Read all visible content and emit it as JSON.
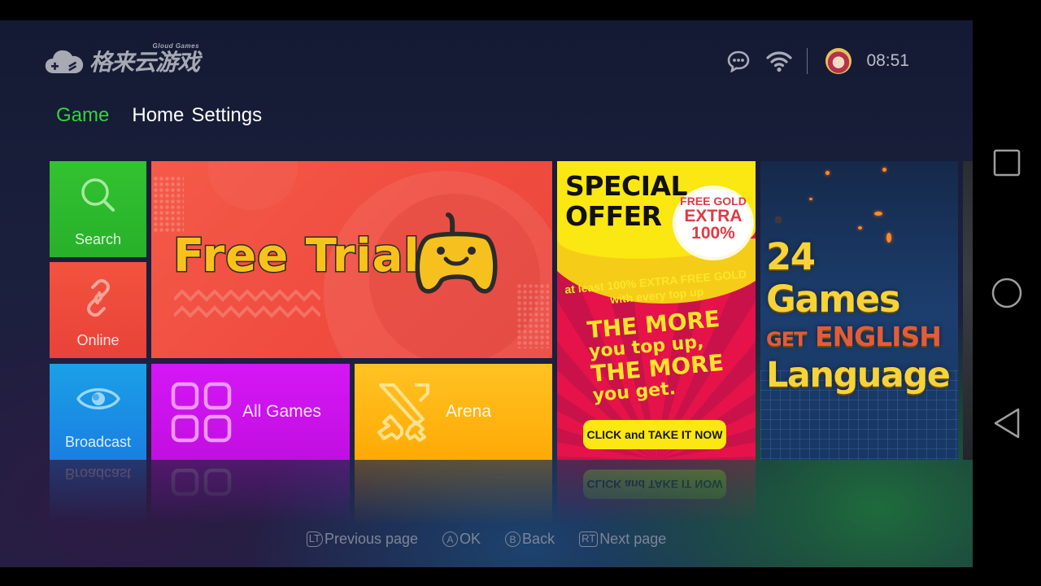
{
  "app": {
    "logo_text": "格来云游戏",
    "logo_subtitle": "Gloud Games"
  },
  "status": {
    "icons": [
      "message-icon",
      "wifi-icon"
    ],
    "time": "08:51"
  },
  "nav": {
    "tabs": [
      {
        "label": "Game",
        "active": true
      },
      {
        "label": "Home",
        "active": false
      },
      {
        "label": "Settings",
        "active": false
      }
    ]
  },
  "tiles": {
    "search": {
      "label": "Search",
      "icon": "search-icon",
      "color": "#2fbd2e"
    },
    "online": {
      "label": "Online",
      "icon": "link-icon",
      "color": "#ef4b3c"
    },
    "broadcast": {
      "label": "Broadcast",
      "icon": "eye-icon",
      "color": "#1a90e4"
    },
    "free_trial": {
      "title": "Free Trial",
      "icon": "gamepad-icon",
      "color": "#f05040"
    },
    "all_games": {
      "label": "All Games",
      "icon": "grid-icon",
      "color": "#cc13ec"
    },
    "arena": {
      "label": "Arena",
      "icon": "crossed-swords-icon",
      "color": "#ffb612"
    },
    "special_offer": {
      "heading_line1": "SPECIAL",
      "heading_line2": "OFFER",
      "badge_line1": "FREE GOLD",
      "badge_line2": "EXTRA",
      "badge_line3": "100%",
      "sub_line1": "at least 100% EXTRA FREE GOLD",
      "sub_line2": "with every top up",
      "big_line1": "THE MORE",
      "big_line2": "you top up,",
      "big_line3": "THE MORE",
      "big_line4": "you get.",
      "cta": "CLICK and TAKE IT NOW"
    },
    "english": {
      "line1": "24 Games",
      "line2_small": "GET",
      "line2_big": "ENGLISH",
      "line3": "Language"
    }
  },
  "hints": [
    {
      "key": "LT",
      "label": "Previous page"
    },
    {
      "key": "A",
      "label": "OK"
    },
    {
      "key": "B",
      "label": "Back"
    },
    {
      "key": "RT",
      "label": "Next page"
    }
  ],
  "system_nav": [
    "recents-button",
    "home-button",
    "back-button"
  ]
}
